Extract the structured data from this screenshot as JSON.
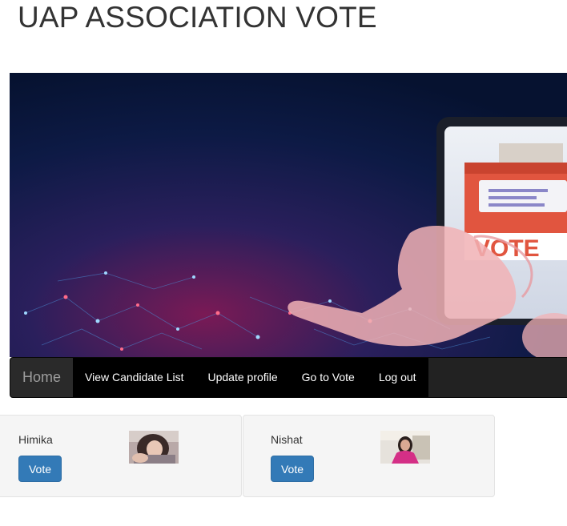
{
  "header": {
    "title": "UAP ASSOCIATION VOTE"
  },
  "banner": {
    "ballot_text": "VOTE"
  },
  "navbar": {
    "brand": "Home",
    "links": [
      "View Candidate List",
      "Update profile",
      "Go to Vote",
      "Log out"
    ]
  },
  "candidates": [
    {
      "name": "Himika",
      "button": "Vote",
      "photo": "candidate-photo"
    },
    {
      "name": "Nishat",
      "button": "Vote",
      "photo": "candidate-photo"
    }
  ],
  "colors": {
    "navbar_bg": "#222222",
    "button_primary": "#337ab7",
    "card_bg": "#f5f5f5"
  }
}
